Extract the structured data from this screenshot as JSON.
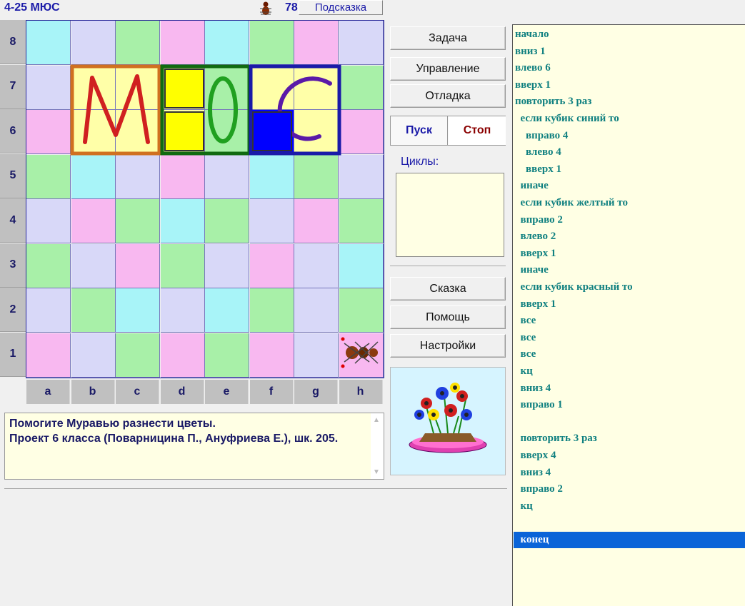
{
  "header": {
    "title": "4-25 МЮС",
    "hint_count": "78",
    "hint_button": "Подсказка"
  },
  "board": {
    "row_labels": [
      "8",
      "7",
      "6",
      "5",
      "4",
      "3",
      "2",
      "1"
    ],
    "col_labels": [
      "a",
      "b",
      "c",
      "d",
      "e",
      "f",
      "g",
      "h"
    ],
    "cells": [
      [
        "cyan",
        "lavender",
        "green",
        "pink",
        "cyan",
        "green",
        "pink",
        "lavender"
      ],
      [
        "lavender",
        "yellow",
        "yellow",
        "yellow",
        "green",
        "yellow",
        "yellow",
        "green"
      ],
      [
        "pink",
        "yellow",
        "yellow",
        "yellow",
        "green",
        "blue",
        "yellow",
        "pink"
      ],
      [
        "green",
        "cyan",
        "lavender",
        "pink",
        "lavender",
        "cyan",
        "green",
        "lavender"
      ],
      [
        "lavender",
        "pink",
        "green",
        "cyan",
        "green",
        "lavender",
        "pink",
        "green"
      ],
      [
        "green",
        "lavender",
        "pink",
        "green",
        "lavender",
        "pink",
        "lavender",
        "cyan"
      ],
      [
        "lavender",
        "green",
        "cyan",
        "lavender",
        "cyan",
        "green",
        "lavender",
        "green"
      ],
      [
        "pink",
        "lavender",
        "green",
        "pink",
        "green",
        "pink",
        "lavender",
        "pink"
      ]
    ],
    "colors": {
      "cyan": "#a8f4f8",
      "lavender": "#d8d8f8",
      "green": "#a8f0a8",
      "pink": "#f8b8f0",
      "yellow": "#ffffa8",
      "blue": "#0000ff"
    },
    "letters": [
      "M",
      "Ю",
      "C"
    ],
    "ant_cell": "h1"
  },
  "panel": {
    "task": "Задача",
    "control": "Управление",
    "debug": "Отладка",
    "run": "Пуск",
    "stop": "Стоп",
    "cycles_label": "Циклы:",
    "story": "Сказка",
    "help": "Помощь",
    "settings": "Настройки"
  },
  "task_text": "Помогите Муравью разнести цветы.\nПроект 6 класса (Поварницина П., Ануфриева Е.), шк. 205.",
  "program": [
    "начало",
    "вниз 1",
    "влево 6",
    "вверх 1",
    "повторить 3 раз",
    "  если кубик синий то",
    "    вправо 4",
    "    влево 4",
    "    вверх 1",
    "  иначе",
    "  если кубик желтый то",
    "  вправо 2",
    "  влево 2",
    "  вверх 1",
    "  иначе",
    "  если кубик красный то",
    "  вверх 1",
    "  все",
    "  все",
    "  все",
    "  кц",
    "  вниз 4",
    "  вправо 1",
    "",
    "  повторить 3 раз",
    "  вверх 4",
    "  вниз 4",
    "  вправо 2",
    "  кц",
    "",
    "  конец"
  ],
  "program_selected_index": 30
}
